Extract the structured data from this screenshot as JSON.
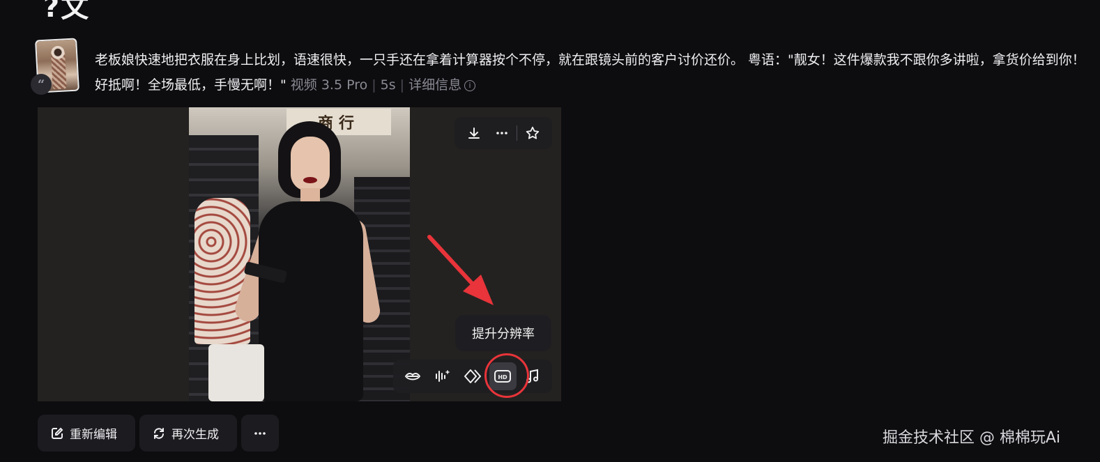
{
  "header": {
    "title_fragment": "?文"
  },
  "prompt": {
    "quote_icon": "quote-icon",
    "text": "老板娘快速地把衣服在身上比划，语速很快，一只手还在拿着计算器按个不停，就在跟镜头前的客户讨价还价。 粤语：\"靓女！这件爆款我不跟你多讲啦，拿货价给到你！好抵啊！全场最低，手慢无啊！\"",
    "model": "视频 3.5 Pro",
    "duration": "5s",
    "details_label": "详细信息"
  },
  "video": {
    "sign_text": "商行",
    "toolbar_top": [
      {
        "icon": "download-icon"
      },
      {
        "icon": "more-icon"
      },
      {
        "icon": "star-icon"
      }
    ],
    "toolbar_bottom": [
      {
        "icon": "lip-sync-icon"
      },
      {
        "icon": "audio-enhance-icon"
      },
      {
        "icon": "frame-interpolate-icon"
      },
      {
        "icon": "hd-icon",
        "label": "HD"
      },
      {
        "icon": "music-icon"
      }
    ],
    "tooltip": "提升分辨率"
  },
  "actions": {
    "re_edit_label": "重新编辑",
    "regenerate_label": "再次生成"
  },
  "watermark": "掘金技术社区 @ 棉棉玩Ai",
  "colors": {
    "background": "#0d0d10",
    "highlight": "#e8343a"
  }
}
